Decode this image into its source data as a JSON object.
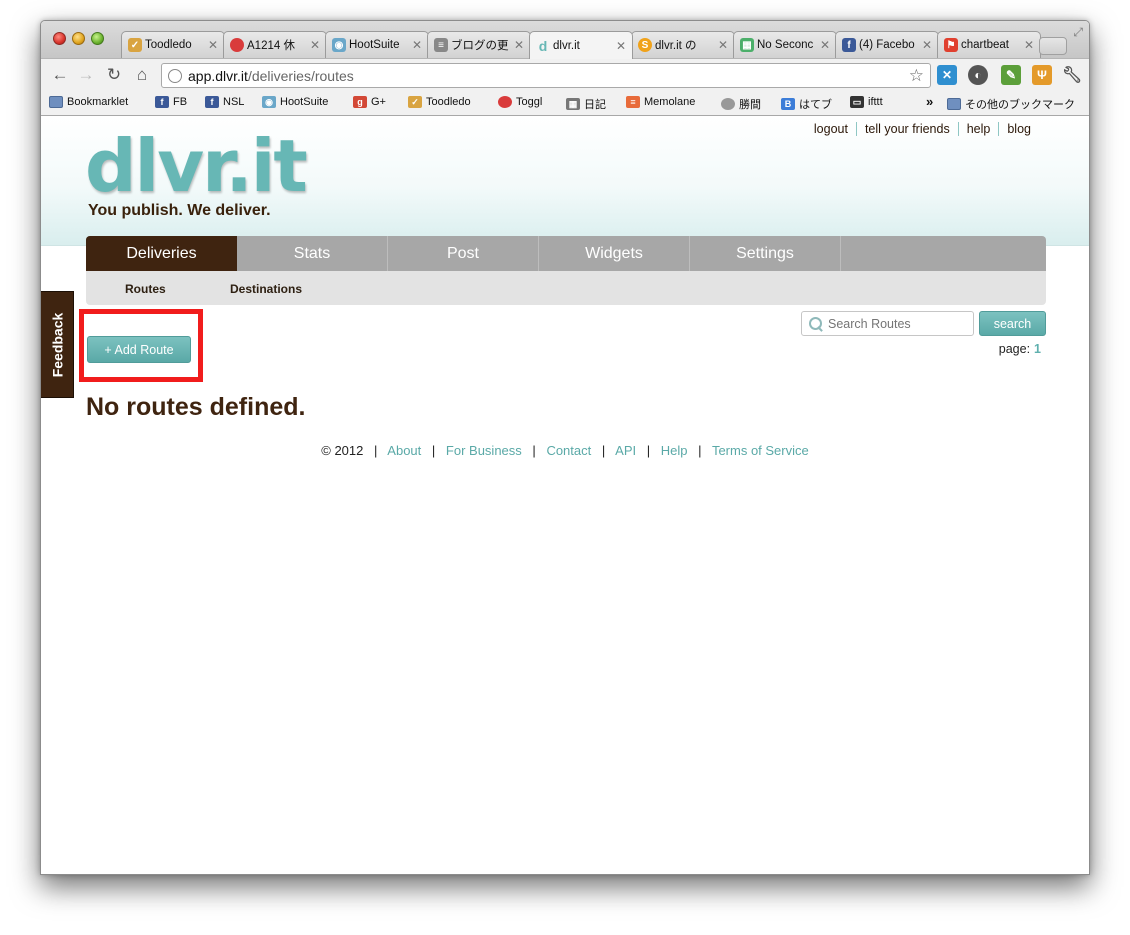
{
  "browser": {
    "tabs": [
      {
        "label": "Toodledo",
        "icon": "checkbox-icon",
        "color": "#d9a441"
      },
      {
        "label": "A1214 休",
        "icon": "record-icon",
        "color": "#d93b3b"
      },
      {
        "label": "HootSuite",
        "icon": "owl-icon",
        "color": "#6aa7c9"
      },
      {
        "label": "ブログの更",
        "icon": "blog-icon",
        "color": "#888888"
      },
      {
        "label": "dlvr.it",
        "icon": "dlvrit-icon",
        "color": "#67b7b5"
      },
      {
        "label": "dlvr.it の",
        "icon": "s-icon",
        "color": "#f0a21a"
      },
      {
        "label": "No Seconc",
        "icon": "grid-icon",
        "color": "#4caf6a"
      },
      {
        "label": "(4) Facebo",
        "icon": "facebook-icon",
        "color": "#3b5998"
      },
      {
        "label": "chartbeat",
        "icon": "chartbeat-icon",
        "color": "#e0402f"
      }
    ],
    "url_host": "app.dlvr.it",
    "url_path": "/deliveries/routes",
    "bookmarks": [
      {
        "label": "Bookmarklet",
        "icon": "folder-icon",
        "color": "#6f8fbf"
      },
      {
        "label": "FB",
        "icon": "facebook-icon",
        "color": "#3b5998"
      },
      {
        "label": "NSL",
        "icon": "facebook-icon",
        "color": "#3b5998"
      },
      {
        "label": "HootSuite",
        "icon": "owl-icon",
        "color": "#6aa7c9"
      },
      {
        "label": "G+",
        "icon": "gplus-icon",
        "color": "#d34836"
      },
      {
        "label": "Toodledo",
        "icon": "checkbox-icon",
        "color": "#d9a441"
      },
      {
        "label": "Toggl",
        "icon": "record-icon",
        "color": "#d93b3b"
      },
      {
        "label": "日記",
        "icon": "grid-icon",
        "color": "#777777"
      },
      {
        "label": "Memolane",
        "icon": "stripes-icon",
        "color": "#e86b3a"
      },
      {
        "label": "勝間",
        "icon": "globe-icon",
        "color": "#999999"
      },
      {
        "label": "はてブ",
        "icon": "hatebu-icon",
        "color": "#3c7dd8"
      },
      {
        "label": "ifttt",
        "icon": "ifttt-icon",
        "color": "#333333"
      }
    ],
    "bookmarks_overflow": "»",
    "other_bookmarks": "その他のブックマーク"
  },
  "site": {
    "logo": "dlvr.it",
    "tagline": "You publish. We deliver.",
    "top_links": [
      "logout",
      "tell your friends",
      "help",
      "blog"
    ],
    "nav_tabs": [
      "Deliveries",
      "Stats",
      "Post",
      "Widgets",
      "Settings"
    ],
    "active_nav": "Deliveries",
    "sub_nav": [
      "Routes",
      "Destinations"
    ],
    "feedback": "Feedback",
    "add_route": "+ Add Route",
    "search_placeholder": "Search Routes",
    "search_button": "search",
    "page_label": "page:",
    "page_number": "1",
    "empty_message": "No routes defined.",
    "footer_copyright": "© 2012",
    "footer_links": [
      "About",
      "For Business",
      "Contact",
      "API",
      "Help",
      "Terms of Service"
    ],
    "accent_color": "#5aa9a7",
    "brand_brown": "#3f2410",
    "highlight_color": "#f11c1c"
  }
}
